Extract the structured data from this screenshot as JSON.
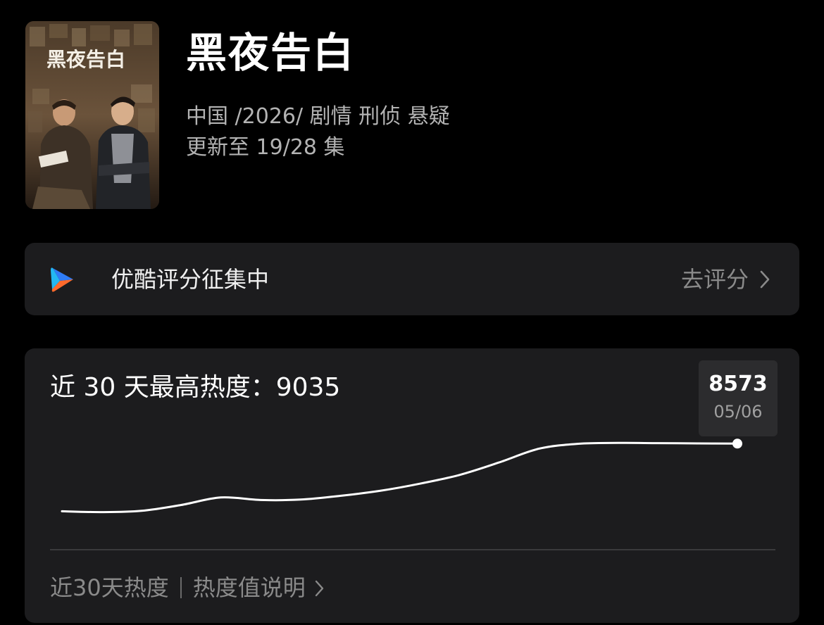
{
  "show": {
    "title": "黑夜告白",
    "meta_line1": "中国 /2026/ 剧情 刑侦 悬疑",
    "meta_line2": "更新至 19/28 集",
    "poster_title": "黑夜告白"
  },
  "rating": {
    "logo_icon": "youku-play-icon",
    "label": "优酷评分征集中",
    "action": "去评分",
    "chevron_icon": "chevron-right-icon"
  },
  "popularity": {
    "heading": "近 30 天最高热度：9035",
    "tooltip_value": "8573",
    "tooltip_date": "05/06",
    "footer_left": "近30天热度",
    "footer_right": "热度值说明",
    "footer_chevron_icon": "chevron-right-icon"
  },
  "chart_data": {
    "type": "line",
    "title": "",
    "xlabel": "",
    "ylabel": "",
    "grid": false,
    "series": [
      {
        "values": [
          6950,
          6930,
          6960,
          7100,
          7280,
          7220,
          7230,
          7320,
          7440,
          7610,
          7820,
          8120,
          8450,
          8570,
          8590,
          8585,
          8578,
          8573
        ]
      }
    ],
    "highlight": {
      "value": 8573,
      "date": "05/06"
    },
    "ylim": [
      6500,
      9035
    ]
  },
  "colors": {
    "background": "#000000",
    "card": "#1c1c1e",
    "line": "#ffffff",
    "youku_blue": "#2f7cf6",
    "youku_orange": "#ff6a2c"
  }
}
